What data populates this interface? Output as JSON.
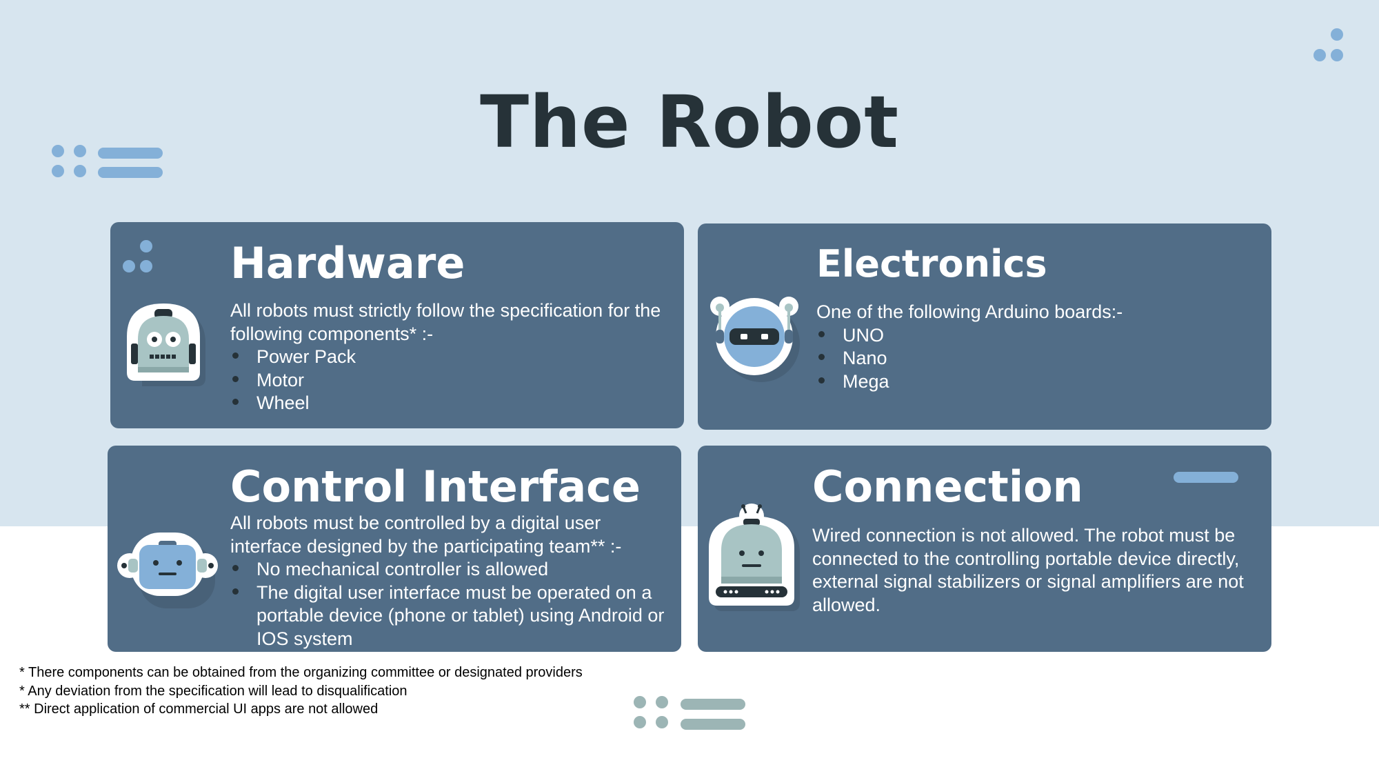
{
  "slide_title": "The Robot",
  "colors": {
    "card_bg": "#516d87",
    "top_bg": "#d7e5ef",
    "title": "#263238",
    "accent_blue": "#84b0d8",
    "accent_grey": "#9cb5b5"
  },
  "cards": [
    {
      "title": "Hardware",
      "intro": "All robots must strictly follow the specification for the following components* :-",
      "items": [
        "Power Pack",
        "Motor",
        "Wheel"
      ],
      "icon": "robot-backpack-icon"
    },
    {
      "title": "Electronics",
      "intro": "One of the following Arduino boards:-",
      "items": [
        "UNO",
        "Nano",
        "Mega"
      ],
      "icon": "robot-visor-icon"
    },
    {
      "title": "Control Interface",
      "intro": "All robots must be controlled by a digital user interface designed by the participating team** :-",
      "items": [
        "No mechanical controller is allowed",
        "The digital user interface must be operated on a portable device (phone or tablet) using Android or IOS system"
      ],
      "icon": "robot-head-icon"
    },
    {
      "title": "Connection",
      "intro": "Wired connection is not allowed. The robot must be connected to the controlling portable device directly, external signal stabilizers or signal amplifiers are not allowed.",
      "items": [],
      "icon": "robot-dome-icon"
    }
  ],
  "footnotes": [
    "* There components can be obtained from the organizing committee or designated providers",
    "* Any deviation from the specification will lead to disqualification",
    "** Direct application of commercial UI apps are not allowed"
  ]
}
